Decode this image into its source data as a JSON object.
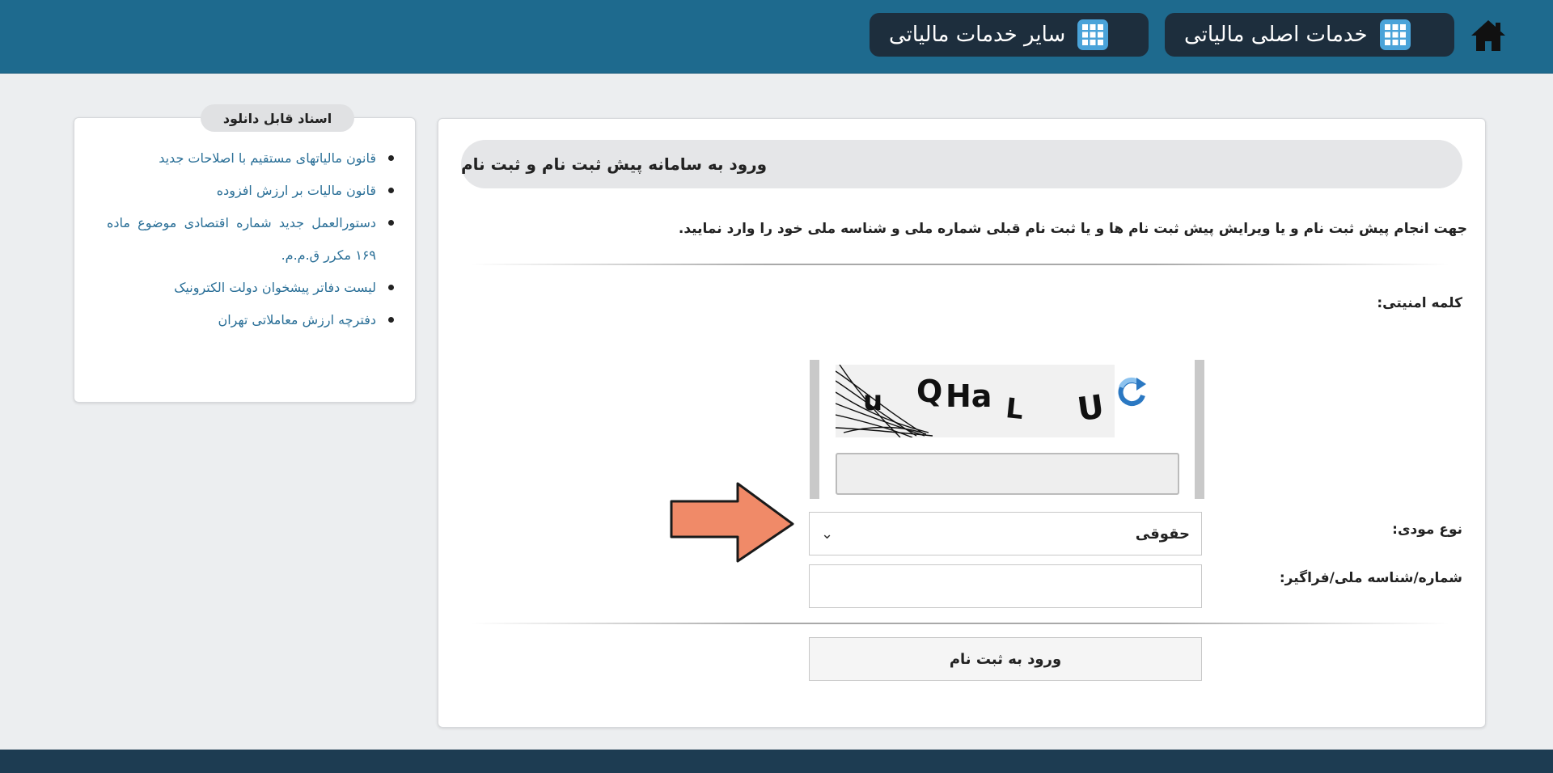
{
  "header": {
    "nav_main_label": "خدمات اصلی مالیاتی",
    "nav_other_label": "سایر خدمات مالیاتی",
    "home_icon": "home-icon",
    "grid_icon": "grid-icon"
  },
  "login": {
    "title": "ورود به سامانه پیش ثبت نام و ثبت نام",
    "intro": "جهت انجام پیش ثبت نام و یا ویرایش پیش ثبت نام ها و یا ثبت نام قبلی شماره ملی و شناسه ملی خود را وارد نمایید.",
    "captcha_label": "کلمه امنیتی:",
    "captcha_text": "u QHa L U",
    "captcha_input_value": "",
    "taxpayer_type_label": "نوع مودی:",
    "taxpayer_type_value": "حقوقی",
    "national_id_label": "شماره/شناسه ملی/فراگیر:",
    "national_id_value": "",
    "submit_label": "ورود به ثبت نام"
  },
  "sidebar": {
    "title": "اسناد قابل دانلود",
    "items": [
      {
        "label": "قانون مالیاتهای مستقیم با اصلاحات جدید"
      },
      {
        "label": "قانون مالیات بر ارزش افزوده"
      },
      {
        "label": "دستورالعمل جدید شماره اقتصادی موضوع ماده ۱۶۹ مکرر ق.م.م."
      },
      {
        "label": "لیست دفاتر پیشخوان دولت الکترونیک"
      },
      {
        "label": "دفترچه ارزش معاملاتی تهران"
      }
    ]
  },
  "colors": {
    "header_bg": "#1e6a8e",
    "nav_button_bg": "#1d2e3d",
    "grid_icon": "#4aa3d9",
    "link": "#2a6f97",
    "arrow_fill": "#f08a68"
  }
}
